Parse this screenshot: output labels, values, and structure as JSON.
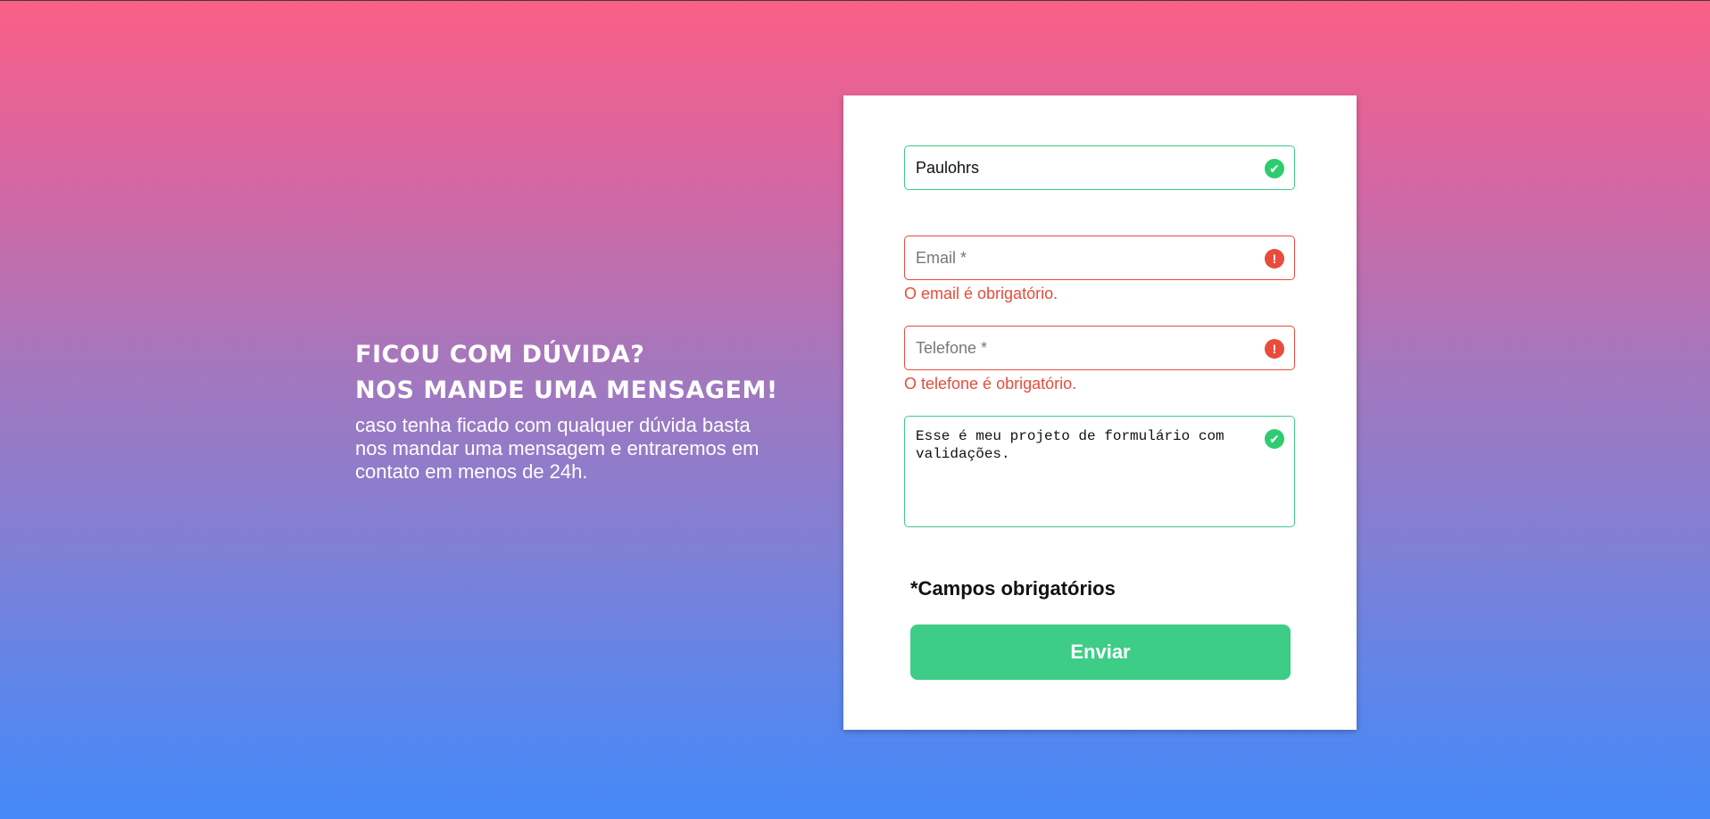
{
  "intro": {
    "heading_line1": "FICOU COM DÚVIDA?",
    "heading_line2": "NOS MANDE UMA MENSAGEM!",
    "text": "caso tenha ficado com qualquer dúvida basta nos mandar uma mensagem e entraremos em contato em menos de 24h."
  },
  "form": {
    "name": {
      "value": "Paulohrs",
      "status": "valid",
      "icon": "check-icon"
    },
    "email": {
      "value": "",
      "placeholder": "Email *",
      "status": "error",
      "icon": "alert-icon",
      "error": "O email é obrigatório."
    },
    "phone": {
      "value": "",
      "placeholder": "Telefone *",
      "status": "error",
      "icon": "alert-icon",
      "error": "O telefone é obrigatório."
    },
    "message": {
      "value": "Esse é meu projeto de formulário com validações.",
      "status": "valid",
      "icon": "check-icon"
    },
    "required_note": "*Campos obrigatórios",
    "submit_label": "Enviar"
  },
  "colors": {
    "valid": "#3ecb85",
    "error": "#e74c3c",
    "button": "#3ecd87",
    "gradient_top": "#fb5f87",
    "gradient_bottom": "#4589f8"
  }
}
